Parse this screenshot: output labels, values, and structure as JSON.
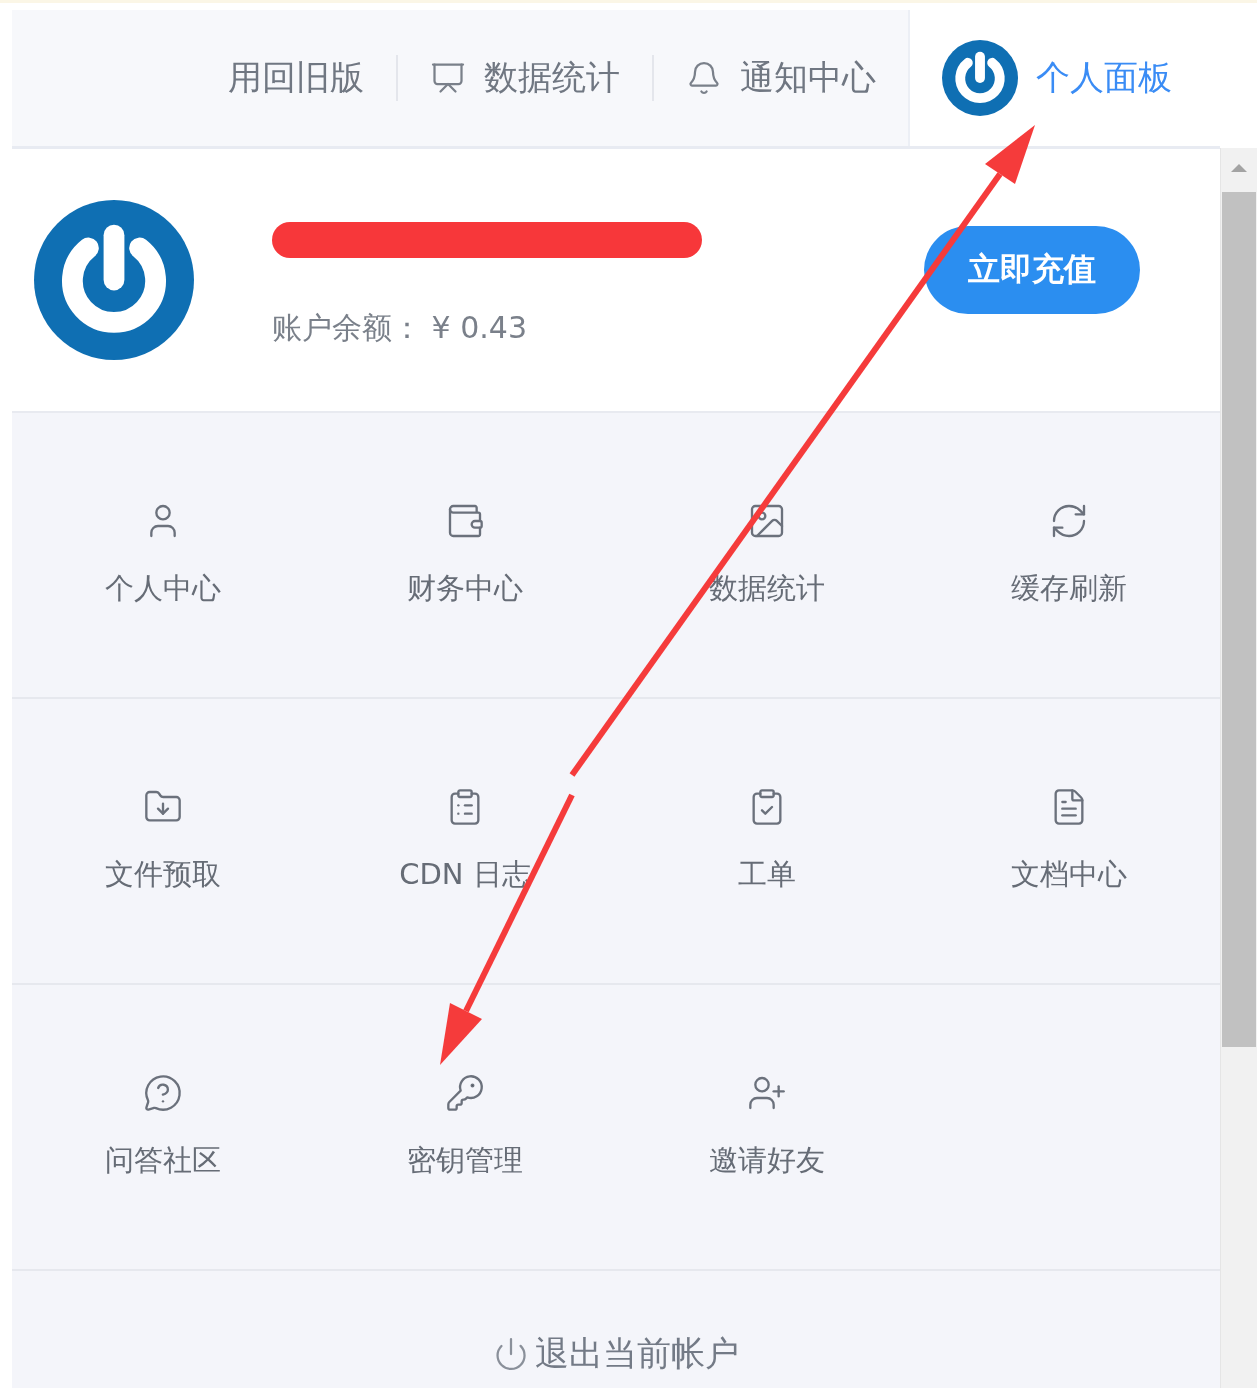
{
  "top_nav": [
    {
      "label": "用回旧版",
      "selected": false
    },
    {
      "label": "数据统计",
      "selected": false
    },
    {
      "label": "通知中心",
      "selected": false
    },
    {
      "label": "个人面板",
      "selected": true
    }
  ],
  "profile": {
    "balance_label": "账户余额：",
    "balance": "¥ 0.43",
    "recharge_button": "立即充值"
  },
  "tiles": [
    {
      "label": "个人中心"
    },
    {
      "label": "财务中心"
    },
    {
      "label": "数据统计"
    },
    {
      "label": "缓存刷新"
    },
    {
      "label": "文件预取"
    },
    {
      "label": "CDN 日志"
    },
    {
      "label": "工单"
    },
    {
      "label": "文档中心"
    },
    {
      "label": "问答社区"
    },
    {
      "label": "密钥管理"
    },
    {
      "label": "邀请好友"
    }
  ],
  "logout": {
    "label": "退出当前帐户"
  }
}
